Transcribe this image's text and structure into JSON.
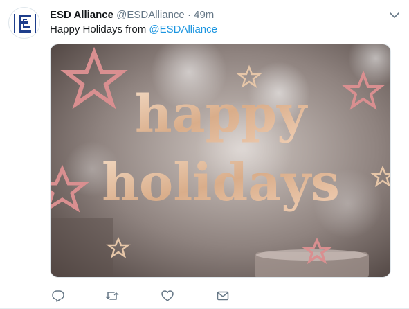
{
  "tweet": {
    "author_name": "ESD Alliance",
    "author_handle": "@ESDAlliance",
    "separator": "·",
    "time": "49m",
    "text_prefix": "Happy Holidays from ",
    "mention": "@ESDAlliance",
    "avatar_logo_text": "ESDA",
    "media": {
      "line1": "happy",
      "line2": "holidays",
      "icon": "star-icon"
    }
  },
  "actions": [
    {
      "name": "reply",
      "icon": "reply-icon"
    },
    {
      "name": "retweet",
      "icon": "retweet-icon"
    },
    {
      "name": "like",
      "icon": "heart-icon"
    },
    {
      "name": "message",
      "icon": "envelope-icon"
    }
  ],
  "colors": {
    "link": "#1b95e0",
    "muted": "#657786",
    "logo": "#1e3e8c",
    "gold": "#e9c6a7",
    "star": "#d98f90"
  }
}
